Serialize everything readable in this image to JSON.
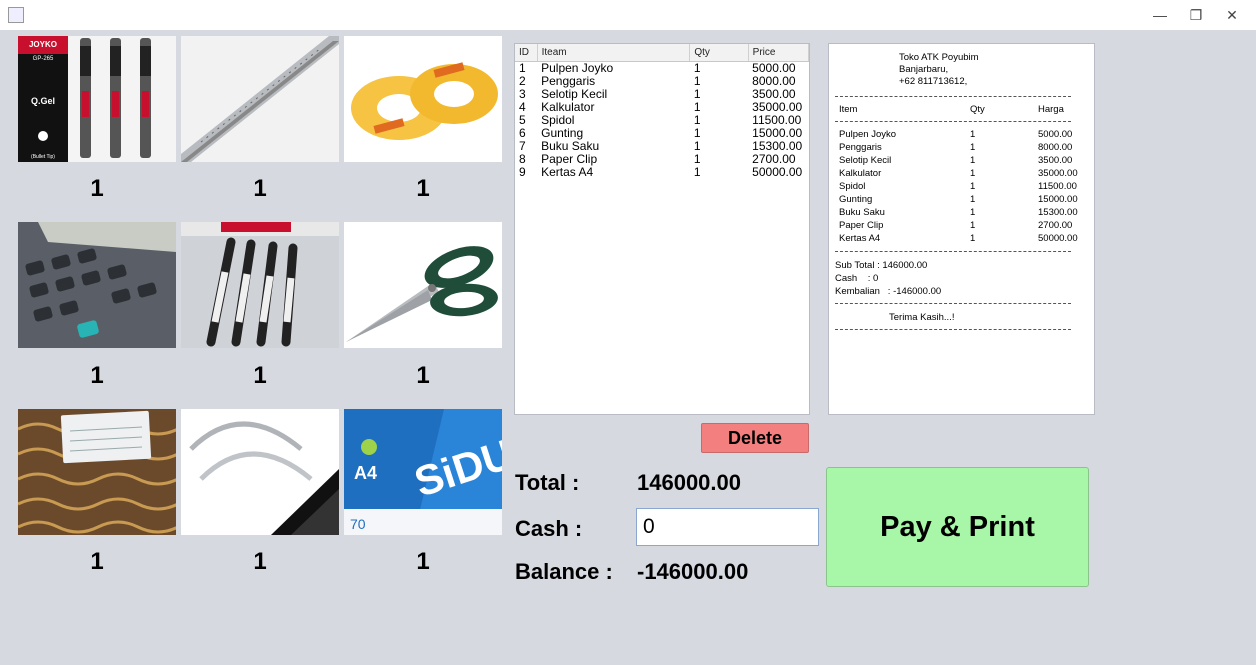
{
  "products": [
    {
      "name": "Pulpen Joyko",
      "qty": "1",
      "icon": "pen-image"
    },
    {
      "name": "Penggaris",
      "qty": "1",
      "icon": "ruler-image"
    },
    {
      "name": "Selotip Kecil",
      "qty": "1",
      "icon": "tape-image"
    },
    {
      "name": "Kalkulator",
      "qty": "1",
      "icon": "calculator-image"
    },
    {
      "name": "Spidol",
      "qty": "1",
      "icon": "marker-image"
    },
    {
      "name": "Gunting",
      "qty": "1",
      "icon": "scissors-image"
    },
    {
      "name": "Buku Saku",
      "qty": "1",
      "icon": "notebook-image"
    },
    {
      "name": "Paper Clip",
      "qty": "1",
      "icon": "binder-clip-image"
    },
    {
      "name": "Kertas A4",
      "qty": "1",
      "icon": "paper-ream-image"
    }
  ],
  "image_text": {
    "pen_brand": "JOYKO",
    "pen_model": "GP-265",
    "pen_label": "Q.Gel",
    "pen_tip": "(Bullet Tip)",
    "paper_brand": "SiDU",
    "paper_size": "A4",
    "paper_gsm": "70"
  },
  "table": {
    "headers": [
      "ID",
      "Iteam",
      "Qty",
      "Price"
    ],
    "rows": [
      [
        "1",
        "Pulpen Joyko",
        "1",
        "5000.00"
      ],
      [
        "2",
        "Penggaris",
        "1",
        "8000.00"
      ],
      [
        "3",
        "Selotip Kecil",
        "1",
        "3500.00"
      ],
      [
        "4",
        "Kalkulator",
        "1",
        "35000.00"
      ],
      [
        "5",
        "Spidol",
        "1",
        "11500.00"
      ],
      [
        "6",
        "Gunting",
        "1",
        "15000.00"
      ],
      [
        "7",
        "Buku Saku",
        "1",
        "15300.00"
      ],
      [
        "8",
        "Paper Clip",
        "1",
        "2700.00"
      ],
      [
        "9",
        "Kertas A4",
        "1",
        "50000.00"
      ]
    ]
  },
  "actions": {
    "delete_label": "Delete",
    "pay_label": "Pay & Print"
  },
  "summary": {
    "total_label": "Total :",
    "total_value": "146000.00",
    "cash_label": "Cash :",
    "cash_value": "0",
    "balance_label": "Balance :",
    "balance_value": "-146000.00"
  },
  "receipt": {
    "store_name": "Toko ATK Poyubim",
    "store_city": "Banjarbaru,",
    "store_phone": "+62 811713612,",
    "col_item": "Item",
    "col_qty": "Qty",
    "col_price": "Harga",
    "items": [
      [
        "Pulpen Joyko",
        "1",
        "5000.00"
      ],
      [
        "Penggaris",
        "1",
        "8000.00"
      ],
      [
        "Selotip Kecil",
        "1",
        "3500.00"
      ],
      [
        "Kalkulator",
        "1",
        "35000.00"
      ],
      [
        "Spidol",
        "1",
        "11500.00"
      ],
      [
        "Gunting",
        "1",
        "15000.00"
      ],
      [
        "Buku Saku",
        "1",
        "15300.00"
      ],
      [
        "Paper Clip",
        "1",
        "2700.00"
      ],
      [
        "Kertas A4",
        "1",
        "50000.00"
      ]
    ],
    "subtotal": "Sub Total : 146000.00",
    "cash": "Cash    : 0",
    "change": "Kembalian   : -146000.00",
    "thanks": "Terima Kasih...!"
  },
  "colors": {
    "background": "#d6d9e0",
    "delete": "#f47f7f",
    "pay": "#a8f7a8"
  }
}
